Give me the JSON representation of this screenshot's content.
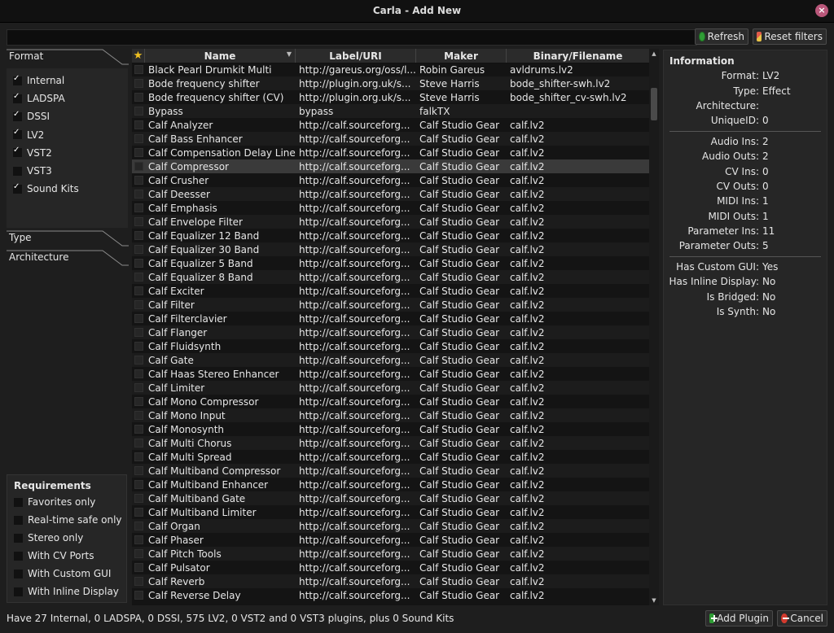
{
  "window": {
    "title": "Carla - Add New"
  },
  "toolbar": {
    "search_value": "",
    "refresh_label": "Refresh",
    "reset_filters_label": "Reset filters"
  },
  "filters": {
    "format_label": "Format",
    "type_label": "Type",
    "architecture_label": "Architecture",
    "formats": [
      {
        "label": "Internal",
        "checked": true
      },
      {
        "label": "LADSPA",
        "checked": true
      },
      {
        "label": "DSSI",
        "checked": true
      },
      {
        "label": "LV2",
        "checked": true
      },
      {
        "label": "VST2",
        "checked": true
      },
      {
        "label": "VST3",
        "checked": false
      },
      {
        "label": "Sound Kits",
        "checked": true
      }
    ]
  },
  "requirements": {
    "title": "Requirements",
    "items": [
      {
        "label": "Favorites only",
        "checked": false
      },
      {
        "label": "Real-time safe only",
        "checked": false
      },
      {
        "label": "Stereo only",
        "checked": false
      },
      {
        "label": "With CV Ports",
        "checked": false
      },
      {
        "label": "With Custom GUI",
        "checked": false
      },
      {
        "label": "With Inline Display",
        "checked": false
      }
    ]
  },
  "table": {
    "columns": [
      "★",
      "Name",
      "Label/URI",
      "Maker",
      "Binary/Filename"
    ],
    "selected_index": 7,
    "rows": [
      [
        "Black Pearl Drumkit Multi",
        "http://gareus.org/oss/l...",
        "Robin Gareus",
        "avldrums.lv2"
      ],
      [
        "Bode frequency shifter",
        "http://plugin.org.uk/s...",
        "Steve Harris",
        "bode_shifter-swh.lv2"
      ],
      [
        "Bode frequency shifter (CV)",
        "http://plugin.org.uk/s...",
        "Steve Harris",
        "bode_shifter_cv-swh.lv2"
      ],
      [
        "Bypass",
        "bypass",
        "falkTX",
        ""
      ],
      [
        "Calf Analyzer",
        "http://calf.sourceforg...",
        "Calf Studio Gear",
        "calf.lv2"
      ],
      [
        "Calf Bass Enhancer",
        "http://calf.sourceforg...",
        "Calf Studio Gear",
        "calf.lv2"
      ],
      [
        "Calf Compensation Delay Line",
        "http://calf.sourceforg...",
        "Calf Studio Gear",
        "calf.lv2"
      ],
      [
        "Calf Compressor",
        "http://calf.sourceforg...",
        "Calf Studio Gear",
        "calf.lv2"
      ],
      [
        "Calf Crusher",
        "http://calf.sourceforg...",
        "Calf Studio Gear",
        "calf.lv2"
      ],
      [
        "Calf Deesser",
        "http://calf.sourceforg...",
        "Calf Studio Gear",
        "calf.lv2"
      ],
      [
        "Calf Emphasis",
        "http://calf.sourceforg...",
        "Calf Studio Gear",
        "calf.lv2"
      ],
      [
        "Calf Envelope Filter",
        "http://calf.sourceforg...",
        "Calf Studio Gear",
        "calf.lv2"
      ],
      [
        "Calf Equalizer 12 Band",
        "http://calf.sourceforg...",
        "Calf Studio Gear",
        "calf.lv2"
      ],
      [
        "Calf Equalizer 30 Band",
        "http://calf.sourceforg...",
        "Calf Studio Gear",
        "calf.lv2"
      ],
      [
        "Calf Equalizer 5 Band",
        "http://calf.sourceforg...",
        "Calf Studio Gear",
        "calf.lv2"
      ],
      [
        "Calf Equalizer 8 Band",
        "http://calf.sourceforg...",
        "Calf Studio Gear",
        "calf.lv2"
      ],
      [
        "Calf Exciter",
        "http://calf.sourceforg...",
        "Calf Studio Gear",
        "calf.lv2"
      ],
      [
        "Calf Filter",
        "http://calf.sourceforg...",
        "Calf Studio Gear",
        "calf.lv2"
      ],
      [
        "Calf Filterclavier",
        "http://calf.sourceforg...",
        "Calf Studio Gear",
        "calf.lv2"
      ],
      [
        "Calf Flanger",
        "http://calf.sourceforg...",
        "Calf Studio Gear",
        "calf.lv2"
      ],
      [
        "Calf Fluidsynth",
        "http://calf.sourceforg...",
        "Calf Studio Gear",
        "calf.lv2"
      ],
      [
        "Calf Gate",
        "http://calf.sourceforg...",
        "Calf Studio Gear",
        "calf.lv2"
      ],
      [
        "Calf Haas Stereo Enhancer",
        "http://calf.sourceforg...",
        "Calf Studio Gear",
        "calf.lv2"
      ],
      [
        "Calf Limiter",
        "http://calf.sourceforg...",
        "Calf Studio Gear",
        "calf.lv2"
      ],
      [
        "Calf Mono Compressor",
        "http://calf.sourceforg...",
        "Calf Studio Gear",
        "calf.lv2"
      ],
      [
        "Calf Mono Input",
        "http://calf.sourceforg...",
        "Calf Studio Gear",
        "calf.lv2"
      ],
      [
        "Calf Monosynth",
        "http://calf.sourceforg...",
        "Calf Studio Gear",
        "calf.lv2"
      ],
      [
        "Calf Multi Chorus",
        "http://calf.sourceforg...",
        "Calf Studio Gear",
        "calf.lv2"
      ],
      [
        "Calf Multi Spread",
        "http://calf.sourceforg...",
        "Calf Studio Gear",
        "calf.lv2"
      ],
      [
        "Calf Multiband Compressor",
        "http://calf.sourceforg...",
        "Calf Studio Gear",
        "calf.lv2"
      ],
      [
        "Calf Multiband Enhancer",
        "http://calf.sourceforg...",
        "Calf Studio Gear",
        "calf.lv2"
      ],
      [
        "Calf Multiband Gate",
        "http://calf.sourceforg...",
        "Calf Studio Gear",
        "calf.lv2"
      ],
      [
        "Calf Multiband Limiter",
        "http://calf.sourceforg...",
        "Calf Studio Gear",
        "calf.lv2"
      ],
      [
        "Calf Organ",
        "http://calf.sourceforg...",
        "Calf Studio Gear",
        "calf.lv2"
      ],
      [
        "Calf Phaser",
        "http://calf.sourceforg...",
        "Calf Studio Gear",
        "calf.lv2"
      ],
      [
        "Calf Pitch Tools",
        "http://calf.sourceforg...",
        "Calf Studio Gear",
        "calf.lv2"
      ],
      [
        "Calf Pulsator",
        "http://calf.sourceforg...",
        "Calf Studio Gear",
        "calf.lv2"
      ],
      [
        "Calf Reverb",
        "http://calf.sourceforg...",
        "Calf Studio Gear",
        "calf.lv2"
      ],
      [
        "Calf Reverse Delay",
        "http://calf.sourceforg...",
        "Calf Studio Gear",
        "calf.lv2"
      ]
    ]
  },
  "info": {
    "title": "Information",
    "groups": [
      [
        {
          "k": "Format:",
          "v": "LV2"
        },
        {
          "k": "Type:",
          "v": "Effect"
        },
        {
          "k": "Architecture:",
          "v": ""
        },
        {
          "k": "UniqueID:",
          "v": "0"
        }
      ],
      [
        {
          "k": "Audio Ins:",
          "v": "2"
        },
        {
          "k": "Audio Outs:",
          "v": "2"
        },
        {
          "k": "CV Ins:",
          "v": "0"
        },
        {
          "k": "CV Outs:",
          "v": "0"
        },
        {
          "k": "MIDI Ins:",
          "v": "1"
        },
        {
          "k": "MIDI Outs:",
          "v": "1"
        },
        {
          "k": "Parameter Ins:",
          "v": "11"
        },
        {
          "k": "Parameter Outs:",
          "v": "5"
        }
      ],
      [
        {
          "k": "Has Custom GUI:",
          "v": "Yes"
        },
        {
          "k": "Has Inline Display:",
          "v": "No"
        },
        {
          "k": "Is Bridged:",
          "v": "No"
        },
        {
          "k": "Is Synth:",
          "v": "No"
        }
      ]
    ]
  },
  "status": "Have 27 Internal, 0 LADSPA, 0 DSSI, 575 LV2, 0 VST2 and 0 VST3 plugins, plus 0 Sound Kits",
  "footer": {
    "add_label": "Add Plugin",
    "cancel_label": "Cancel"
  }
}
